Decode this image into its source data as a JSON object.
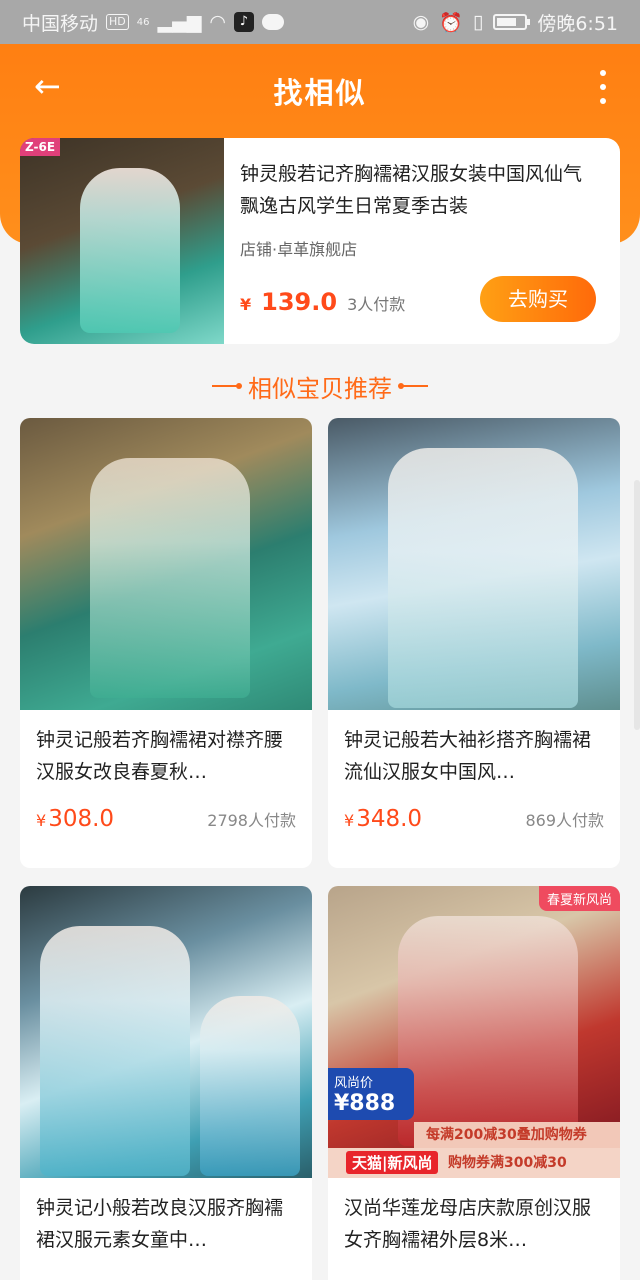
{
  "status_bar": {
    "carrier": "中国移动",
    "hd": "HD",
    "network": "46",
    "time": "傍晚6:51",
    "battery_level": 0.7
  },
  "header": {
    "title": "找相似",
    "back_icon": "arrow-left-icon",
    "more_icon": "more-vertical-icon"
  },
  "main_product": {
    "image_tag": "Z-6E",
    "title": "钟灵般若记齐胸襦裙汉服女装中国风仙气飘逸古风学生日常夏季古装",
    "store": "店铺·卓革旗舰店",
    "currency": "¥",
    "price": "139.0",
    "paid_count": "3人付款",
    "buy_label": "去购买"
  },
  "section": {
    "heading": "相似宝贝推荐"
  },
  "products": [
    {
      "title": "钟灵记般若齐胸襦裙对襟齐腰汉服女改良春夏秋…",
      "currency": "¥",
      "price": "308.0",
      "paid": "2798人付款"
    },
    {
      "title": "钟灵记般若大袖衫搭齐胸襦裙流仙汉服女中国风…",
      "currency": "¥",
      "price": "348.0",
      "paid": "869人付款"
    },
    {
      "title": "钟灵记小般若改良汉服齐胸襦裙汉服元素女童中…"
    },
    {
      "title": "汉尚华莲龙母店庆款原创汉服女齐胸襦裙外层8米…",
      "ribbon": "春夏新风尚",
      "promo_label": "风尚价",
      "promo_price": "¥888",
      "promo_line1": "每满200减30叠加购物券",
      "promo_line2": "购物券满300减30",
      "tmall_badge": "天猫|新风尚"
    }
  ]
}
